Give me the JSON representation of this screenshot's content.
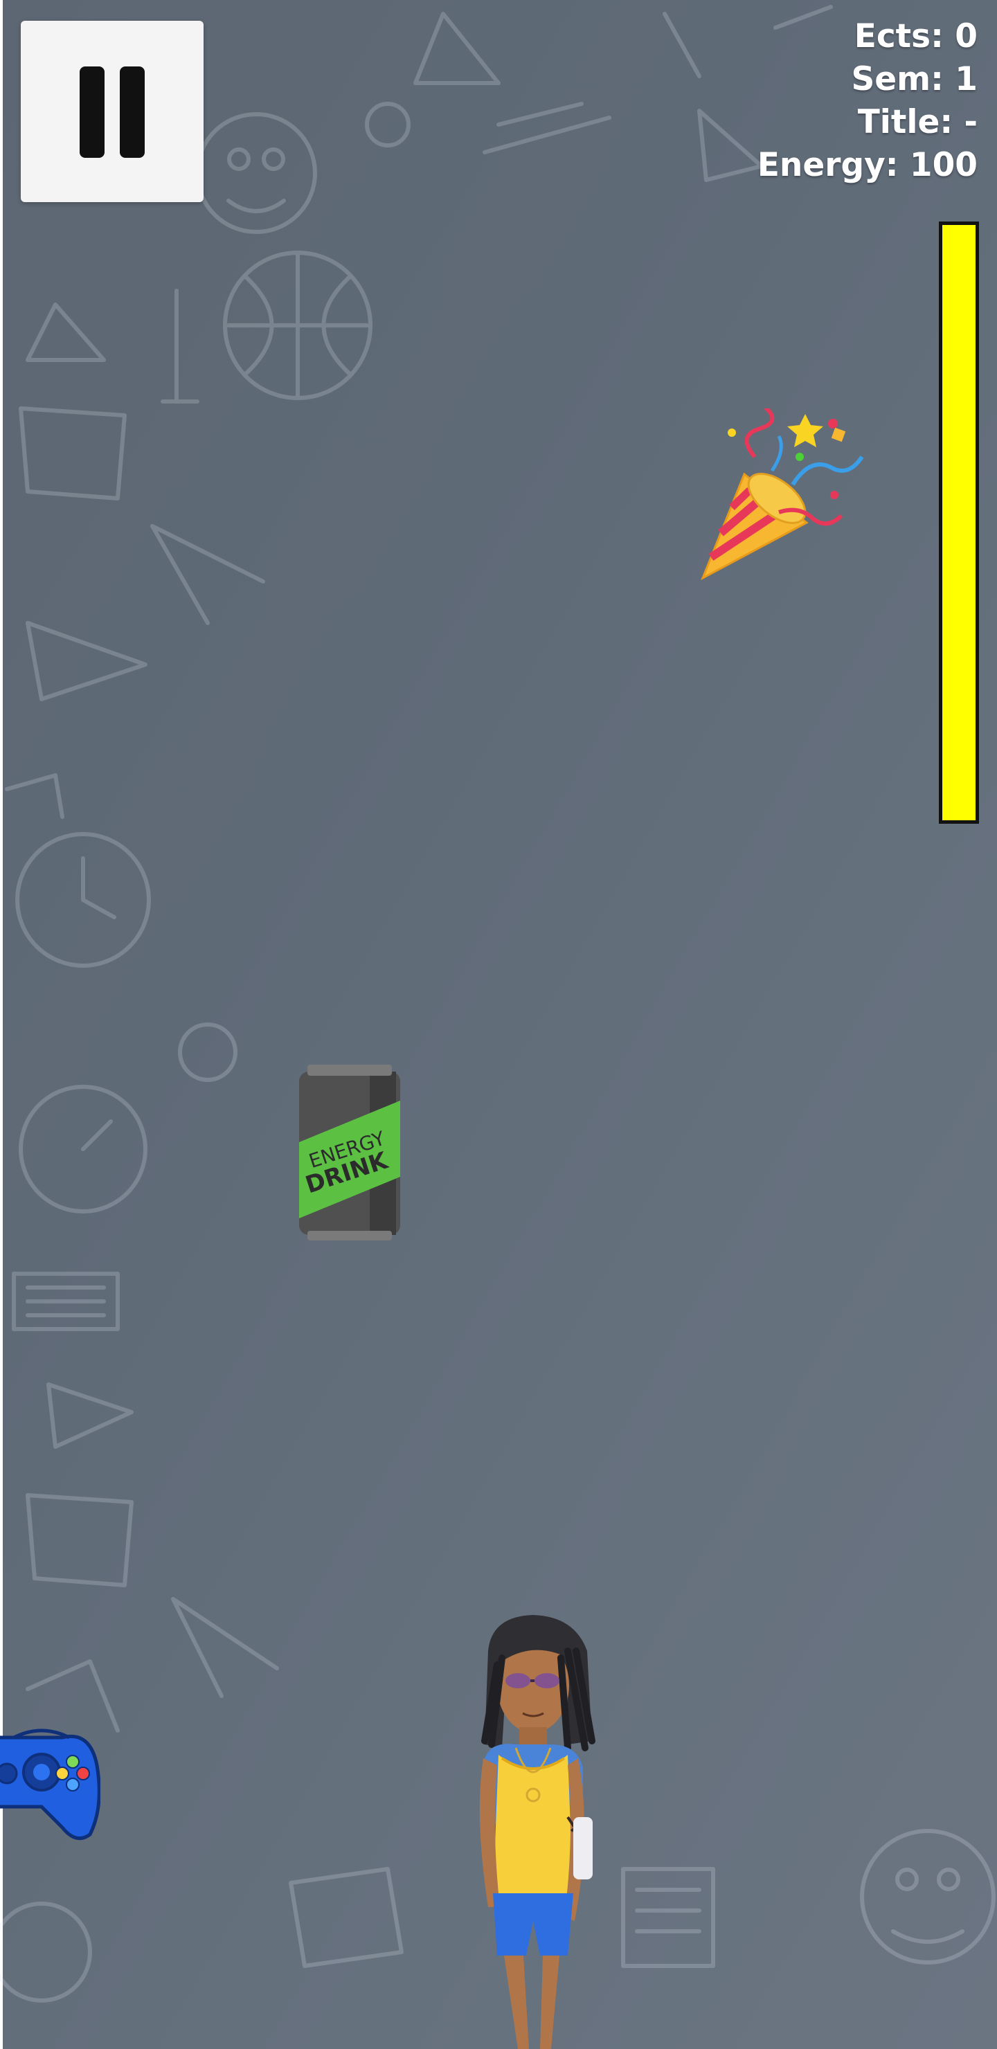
{
  "hud": {
    "ects": "Ects: 0",
    "semester": "Sem: 1",
    "title": "Title: -",
    "energy": "Energy: 100"
  },
  "energy_bar": {
    "level_percent": 100,
    "fill_color": "#ffff00",
    "border_color": "#111111"
  },
  "pause_button": {
    "icon": "pause-icon"
  },
  "items": {
    "party_popper": {
      "icon": "party-popper-icon"
    },
    "energy_drink": {
      "icon": "energy-drink-can-icon",
      "label_line1": "ENERGY",
      "label_line2": "DRINK",
      "label_color": "#5cc043"
    },
    "gamepad": {
      "icon": "gamepad-icon",
      "color": "#1f5fe0"
    }
  },
  "player": {
    "icon": "student-character-icon"
  },
  "colors": {
    "background": "#5f6a77",
    "hud_text": "#ffffff"
  }
}
